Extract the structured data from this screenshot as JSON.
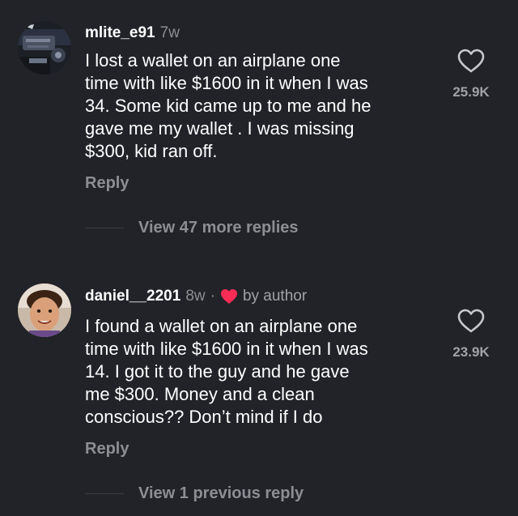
{
  "comments": [
    {
      "username": "mlite_e91",
      "time": "7w",
      "avatar_icon": "engine-photo-avatar",
      "text_lines": [
        "I lost a wallet on an airplane one",
        "time with like $1600 in it when I was",
        "34. Some kid came up to me and he",
        "gave me my wallet . I was missing",
        "$300, kid ran off."
      ],
      "reply_label": "Reply",
      "like_count": "25.9K",
      "view_replies_label": "View 47 more replies"
    },
    {
      "username": "daniel__2201",
      "time": "8w",
      "separator": "·",
      "liked_by_author_icon": "red-heart-icon",
      "by_author_label": "by author",
      "avatar_icon": "child-photo-avatar",
      "text_lines": [
        "I found a wallet on an airplane one",
        "time with like $1600 in it when I was",
        "14. I got it to the guy and he gave",
        "me $300. Money and a clean",
        "conscious?? Don’t mind if I do"
      ],
      "reply_label": "Reply",
      "like_count": "23.9K",
      "view_replies_label": "View 1 previous reply"
    }
  ],
  "colors": {
    "background": "#222329",
    "primary_text": "#ffffff",
    "secondary_text": "#8d8e93",
    "heart_red": "#fe2c55"
  }
}
